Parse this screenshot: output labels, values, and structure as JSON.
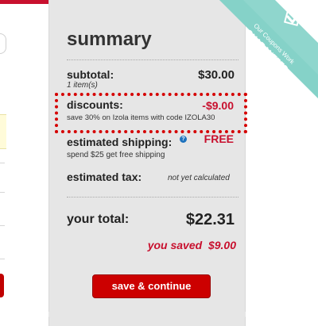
{
  "summary": {
    "title": "summary",
    "subtotal_label": "subtotal:",
    "subtotal_amount": "$30.00",
    "items_count": "1 item(s)",
    "discounts_label": "discounts:",
    "discounts_amount": "-$9.00",
    "discount_note": "save 30% on Izola items with code IZOLA30",
    "shipping_label": "estimated shipping:",
    "shipping_amount": "FREE",
    "shipping_note": "spend $25 get free shipping",
    "tax_label": "estimated tax:",
    "tax_value": "not yet calculated",
    "total_label": "your total:",
    "total_amount": "$22.31",
    "saved_label": "you saved",
    "saved_amount": "$9.00",
    "continue_button": "save & continue"
  },
  "badge": {
    "line1": "Our Coupons Work",
    "line2": "GUARANTEED",
    "icon": "check-square-icon",
    "color": "#7ecfc4"
  },
  "colors": {
    "accent_red": "#c8102e",
    "button_red": "#cc0000",
    "panel_bg": "#e6e6e6"
  }
}
